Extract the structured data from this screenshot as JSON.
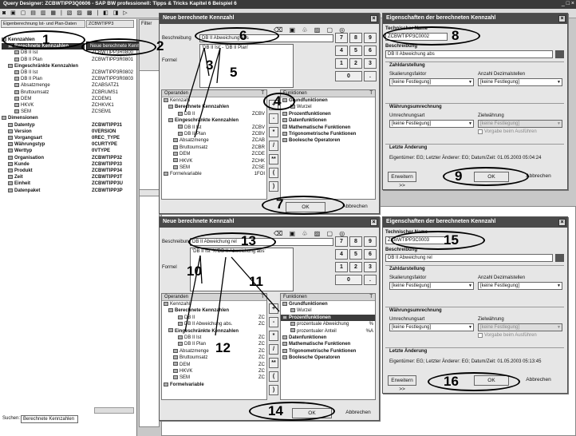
{
  "app_title": "Query Designer: ZCBWTIPP3Q0606 - SAP BW professionell: Tipps & Tricks Kapitel 6 Beispiel 6",
  "left_tabs": [
    "Eigenberechnung Ist- und Plan-Daten",
    "ZCBWTIPP3"
  ],
  "filter_label": "Filter",
  "tree": [
    {
      "label": "Kennzahlen",
      "tech": "",
      "bold": true
    },
    {
      "label": "Berechnete Kennzahlen",
      "tech": "",
      "bold": true,
      "sel": true
    },
    {
      "label": "DB II Ist",
      "tech": "ZCBWTIPP3R0800"
    },
    {
      "label": "DB II Plan",
      "tech": "ZCBWTIPP3R0801"
    },
    {
      "label": "Eingeschränkte Kennzahlen",
      "tech": "",
      "bold": true
    },
    {
      "label": "DB II Ist",
      "tech": "ZCBWTIPP3R0802"
    },
    {
      "label": "DB II Plan",
      "tech": "ZCBWTIPP3R0803"
    },
    {
      "label": "Absatzmenge",
      "tech": "ZCABSATZ1"
    },
    {
      "label": "Bruttoumsatz",
      "tech": "ZCBRUMS1"
    },
    {
      "label": "DEM",
      "tech": "ZCDEM1"
    },
    {
      "label": "HKVK",
      "tech": "ZCHKVK1"
    },
    {
      "label": "SEM",
      "tech": "ZCSEM1"
    },
    {
      "label": "Dimensionen",
      "tech": "",
      "bold": true
    },
    {
      "label": "Datentyp",
      "tech": "ZCBWTIPP31",
      "bold": true
    },
    {
      "label": "Version",
      "tech": "0VERSION",
      "bold": true
    },
    {
      "label": "Vorgangsart",
      "tech": "0REC_TYPE",
      "bold": true
    },
    {
      "label": "Währungstyp",
      "tech": "0CURTYPE",
      "bold": true
    },
    {
      "label": "Werttyp",
      "tech": "0VTYPE",
      "bold": true
    },
    {
      "label": "Organisation",
      "tech": "ZCBWTIPP32",
      "bold": true
    },
    {
      "label": "Kunde",
      "tech": "ZCBWTIPP33",
      "bold": true
    },
    {
      "label": "Produkt",
      "tech": "ZCBWTIPP34",
      "bold": true
    },
    {
      "label": "Zeit",
      "tech": "ZCBWTIPP3T",
      "bold": true
    },
    {
      "label": "Einheit",
      "tech": "ZCBWTIPP3U",
      "bold": true
    },
    {
      "label": "Datenpaket",
      "tech": "ZCBWTIPP3P",
      "bold": true
    }
  ],
  "context_menu": "Neue berechnete Kennzahl",
  "search": {
    "label": "Suchen:",
    "value": "Berechnete Kennzahlen"
  },
  "dlg1": {
    "title": "Neue berechnete Kennzahl",
    "desc_label": "Beschreibung",
    "desc_value": "DB II Abweichung abs",
    "formula_label": "Formel",
    "formula_value": "'DB II Ist' - 'DB II Plan'",
    "ops_header": "Operanden",
    "ops_t": "T",
    "ops": [
      {
        "label": "Kennzahl",
        "code": ""
      },
      {
        "label": "Berechnete Kennzahlen",
        "code": ""
      },
      {
        "label": "DB II",
        "code": "ZCBV"
      },
      {
        "label": "Eingeschränkte Kennzahlen",
        "code": ""
      },
      {
        "label": "DB II Ist",
        "code": "ZCBV"
      },
      {
        "label": "DB II Plan",
        "code": "ZCBV"
      },
      {
        "label": "Absatzmenge",
        "code": "ZCAB"
      },
      {
        "label": "Bruttoumsatz",
        "code": "ZCBR"
      },
      {
        "label": "DEM",
        "code": "ZCDE"
      },
      {
        "label": "HKVK",
        "code": "ZCHK"
      },
      {
        "label": "SEM",
        "code": "ZCSE"
      },
      {
        "label": "Formelvariable",
        "code": "1FOI"
      }
    ],
    "funcs_header": "Funktionen",
    "funcs": [
      "Grundfunktionen",
      "Wurzel",
      "Prozentfunktionen",
      "Datenfunktionen",
      "Mathematische Funktionen",
      "Trigonometrische Funktionen",
      "Boolesche Operatoren"
    ],
    "ok": "OK",
    "cancel": "Abbrechen"
  },
  "dlg2": {
    "title": "Neue berechnete Kennzahl",
    "desc_label": "Beschreibung",
    "desc_value": "DB II Abweichung rel",
    "formula_label": "Formel",
    "formula_value": "'DB II Ist' %'DB II Abweichung abs'",
    "ops": [
      {
        "label": "Kennzahl",
        "code": ""
      },
      {
        "label": "Berechnete Kennzahlen",
        "code": ""
      },
      {
        "label": "DB II",
        "code": "ZC"
      },
      {
        "label": "DB II Abweichung abs.",
        "code": "ZC"
      },
      {
        "label": "Eingeschränkte Kennzahlen",
        "code": ""
      },
      {
        "label": "DB II Ist",
        "code": "ZC"
      },
      {
        "label": "DB II Plan",
        "code": "ZC"
      },
      {
        "label": "Absatzmenge",
        "code": "ZC"
      },
      {
        "label": "Bruttoumsatz",
        "code": "ZC"
      },
      {
        "label": "DEM",
        "code": "ZC"
      },
      {
        "label": "HKVK",
        "code": "ZC"
      },
      {
        "label": "SEM",
        "code": "ZC"
      },
      {
        "label": "Formelvariable",
        "code": ""
      }
    ],
    "funcs": [
      {
        "label": "Grundfunktionen",
        "code": ""
      },
      {
        "label": "Wurzel",
        "code": ""
      },
      {
        "label": "Prozentfunktionen",
        "code": ""
      },
      {
        "label": "prozentuale Abweichung",
        "code": "%"
      },
      {
        "label": "prozentualer Anteil",
        "code": "%A"
      },
      {
        "label": "Datenfunktionen",
        "code": ""
      },
      {
        "label": "Mathematische Funktionen",
        "code": ""
      },
      {
        "label": "Trigonometrische Funktionen",
        "code": ""
      },
      {
        "label": "Boolesche Operatoren",
        "code": ""
      }
    ]
  },
  "prop1": {
    "title": "Eigenschaften der berechneten Kennzahl",
    "tech_label": "Technischer Name",
    "tech_value": "ZCBWTIPP3C0002",
    "desc_label": "Beschreibung",
    "desc_value": "DB II Abweichung abs",
    "zahl_label": "Zahldarstellung",
    "scale_label": "Skalierungsfaktor",
    "scale_value": "[keine Festlegung]",
    "dec_label": "Anzahl Dezimalstellen",
    "dec_value": "[keine Festlegung]",
    "waehr_label": "Währungsumrechnung",
    "conv_label": "Umrechnungsart",
    "conv_value": "[keine Festlegung]",
    "target_label": "Zielwährung",
    "target_value": "[keine Festlegung]",
    "query_cb": "Vorgabe beim Ausführen",
    "last_label": "Letzte Änderung",
    "last_value": "Eigentümer: EG; Letzter Änderer: EG; Datum/Zeit: 01.05.2003 05:04:24",
    "extend": "Erweitern >>",
    "ok": "OK",
    "cancel": "Abbrechen"
  },
  "prop2": {
    "title": "Eigenschaften der berechneten Kennzahl",
    "tech_value": "ZCBWTIPP3C0003",
    "desc_value": "DB II Abweichung rel",
    "last_value": "Eigentümer: EG; Letzter Änderer: EG; Datum/Zeit: 01.05.2003 05:13:45"
  },
  "keypad": [
    "7",
    "8",
    "9",
    "4",
    "5",
    "6",
    "1",
    "2",
    "3",
    "0",
    "."
  ],
  "op_buttons": [
    "+",
    "-",
    "*",
    "/",
    "**",
    "(",
    ")"
  ],
  "callouts": [
    "1",
    "2",
    "3",
    "4",
    "5",
    "6",
    "7",
    "8",
    "9",
    "10",
    "11",
    "12",
    "13",
    "14",
    "15",
    "16"
  ]
}
